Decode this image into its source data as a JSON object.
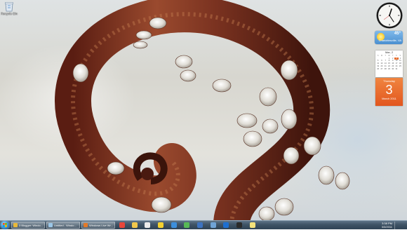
{
  "desktop": {
    "icons": [
      {
        "label": "Recycle Bin",
        "icon": "recycle-bin-icon"
      }
    ]
  },
  "gadgets": {
    "clock": {
      "icon": "analog-clock-icon"
    },
    "weather": {
      "temperature": "45°",
      "city": "Charlottesville, VA",
      "icon": "sun-icon"
    },
    "calendar_month": {
      "month_label": "Mar, 2",
      "weekdays": [
        "S",
        "M",
        "T",
        "W",
        "T",
        "F",
        "S"
      ],
      "days": [
        "",
        "",
        "",
        "1",
        "2",
        "3",
        "4",
        "5",
        "6",
        "7",
        "8",
        "9",
        "10",
        "11",
        "12",
        "13",
        "14",
        "15",
        "16",
        "17",
        "18",
        "19",
        "20",
        "21",
        "22",
        "23",
        "24",
        "25",
        "26",
        "27",
        "28",
        "29",
        "30",
        "31",
        "",
        ""
      ],
      "today": "3"
    },
    "calendar_day": {
      "weekday": "Thursday",
      "day": "3",
      "month_year": "March 2011"
    }
  },
  "taskbar": {
    "start_icon": "windows-logo-icon",
    "buttons": [
      {
        "label": "3 Blogger: Windo...",
        "icon": "chrome-icon",
        "color": "#e8b93a"
      },
      {
        "label": "Untitled - Windo...",
        "icon": "paint-icon",
        "color": "#9bc7e8"
      },
      {
        "label": "Windows Live Wr...",
        "icon": "writer-icon",
        "color": "#e27a2a"
      }
    ],
    "pinned": [
      {
        "icon": "chrome-pinned-icon",
        "color": "#e7463b"
      },
      {
        "icon": "folder-icon",
        "color": "#f1c84b"
      },
      {
        "icon": "media-player-icon",
        "color": "#ececec"
      },
      {
        "icon": "mail-icon",
        "color": "#f4d12f"
      },
      {
        "icon": "ie-icon",
        "color": "#3c8fdc"
      },
      {
        "icon": "messenger-icon",
        "color": "#57b956"
      },
      {
        "icon": "calculator-icon",
        "color": "#3d73c0"
      },
      {
        "icon": "network-icon",
        "color": "#6fa3d6"
      },
      {
        "icon": "window-app-icon",
        "color": "#1e6fd0"
      },
      {
        "icon": "terminal-icon",
        "color": "#2a2a2a"
      },
      {
        "icon": "notes-icon",
        "color": "#f4e27a"
      }
    ],
    "tray": {
      "time": "3:38 PM",
      "date": "3/3/2011"
    }
  }
}
